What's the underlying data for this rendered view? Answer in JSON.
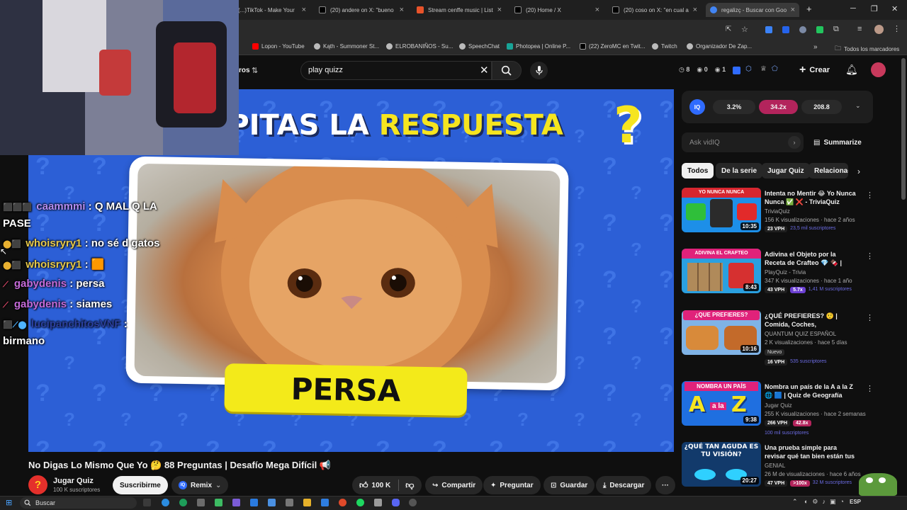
{
  "browser": {
    "tabs": [
      {
        "label": "(...)TikTok - Make Your",
        "color": "#111111"
      },
      {
        "label": "(20) andere on X: \"bueno",
        "color": "#000000"
      },
      {
        "label": "Stream cenffe music | List",
        "color": "#e8532a"
      },
      {
        "label": "(20) Home / X",
        "color": "#000000"
      },
      {
        "label": "(20) coso on X: \"en cual a",
        "color": "#000000"
      },
      {
        "label": "regalizç - Buscar con Goo",
        "color": "#4285f4"
      }
    ],
    "new_tab": "+",
    "bookmarks": [
      {
        "label": "Lopon - YouTube",
        "color": "#ff0000"
      },
      {
        "label": "Kąth - Summoner St...",
        "color": "#bbbbbb"
      },
      {
        "label": "ELROBANIÑOS - Su...",
        "color": "#bbbbbb"
      },
      {
        "label": "SpeechChat",
        "color": "#bbbbbb"
      },
      {
        "label": "Photopea | Online P...",
        "color": "#18a497"
      },
      {
        "label": "(22) ZeroMC en Twit...",
        "color": "#000000"
      },
      {
        "label": "Twitch",
        "color": "#bbbbbb"
      },
      {
        "label": "Organizador De Zap...",
        "color": "#bbbbbb"
      }
    ],
    "bookmarks_overflow": "»",
    "all_bookmarks": "Todos los marcadores"
  },
  "youtube": {
    "filters_fragment": "ros",
    "search_value": "play quizz",
    "stats": {
      "a": "8",
      "b": "0",
      "c": "1"
    },
    "create_label": "Crear",
    "vidiq": {
      "v1": "3.2%",
      "v2": "34.2x",
      "v3": "208.8",
      "ask_placeholder": "Ask vidIQ",
      "summarize": "Summarize"
    },
    "chips": [
      "Todos",
      "De la serie",
      "Jugar Quiz",
      "Relacionad"
    ],
    "video": {
      "banner_white": "EPITAS LA",
      "banner_yellow": "RESPUESTA",
      "answer": "PERSA",
      "question_mark": "?"
    },
    "video_title": "No Digas Lo Mismo Que Yo 🤔 88 Preguntas | Desafío Mega Difícil 📢",
    "channel": {
      "name": "Jugar Quiz",
      "subs": "100 K suscriptores",
      "subscribe": "Suscribirme",
      "remix": "Remix"
    },
    "actions": {
      "likes": "100 K",
      "share": "Compartir",
      "ask": "Preguntar",
      "save": "Guardar",
      "download": "Descargar",
      "more": "···"
    },
    "recommendations": [
      {
        "thumb_text": "YO NUNCA NUNCA",
        "dur": "10:35",
        "title": "Intenta no Mentir 😂 Yo Nunca Nunca ✅ ❌ - TriviaQuiz Part...",
        "channel": "TriviaQuiz",
        "meta": "156 K visualizaciones · hace 2 años",
        "vph": "23 VPH",
        "mult": "",
        "subs": "23,5 mil suscriptores",
        "thumb_color": "#1d8fe8"
      },
      {
        "thumb_text": "ADIVINA EL CRAFTEO",
        "dur": "8:43",
        "title": "Adivina el Objeto por la Receta de Crafteo 💎 🍫 | ¿Cuánto ...",
        "channel": "PlayQuiz - Trivia",
        "meta": "347 K visualizaciones · hace 1 año",
        "vph": "43 VPH",
        "mult": "5.7x",
        "subs": "1,41 M suscriptores",
        "thumb_color": "#2aa0e0"
      },
      {
        "thumb_text": "¿QUE PREFIERES?",
        "dur": "10:16",
        "title": "¿QUÉ PREFIERES? 🤨 | Comida, Coches, Superpoderes y ...",
        "channel": "QUANTUM QUIZ ESPAÑOL",
        "meta": "2 K visualizaciones · hace 5 días",
        "new": "Nuevo",
        "vph": "16 VPH",
        "mult": "",
        "subs": "535 suscriptores",
        "thumb_color": "#7fb3e6"
      },
      {
        "thumb_text": "NOMBRA UN PAÍS",
        "dur": "9:38",
        "title": "Nombra un país de la A a la Z 🌐 🟦 | Quiz de Geografía",
        "channel": "Jugar Quiz",
        "meta": "255 K visualizaciones · hace 2 semanas",
        "vph": "266 VPH",
        "mult": "42.8x",
        "subs": "100 mil suscriptores",
        "thumb_color": "#1f6fe0"
      },
      {
        "thumb_text": "¿QUÉ TAN AGUDA ES TU VISIÓN?",
        "dur": "20:27",
        "title": "Una prueba simple para revisar qué tan bien están tus ojos",
        "channel": "GENIAL",
        "meta": "26 M de visualizaciones · hace 6 años",
        "vph": "47 VPH",
        "mult": ">100x",
        "subs": "32 M suscriptores",
        "thumb_color": "#123a6b"
      }
    ]
  },
  "chat": [
    {
      "user": "caammmi",
      "msg": ": Q MAL Q LA",
      "cont": "PASE",
      "color": "#b58ef2"
    },
    {
      "user": "whoisryry1",
      "msg": ": no sé d gatos",
      "color": "#e6c84a"
    },
    {
      "user": "whoisryry1",
      "msg": ": 🟧",
      "color": "#e6c84a"
    },
    {
      "user": "gabydenis",
      "msg": ": persa",
      "color": "#c46ad8"
    },
    {
      "user": "gabydenis",
      "msg": ": siames",
      "color": "#c46ad8"
    },
    {
      "user": "lucipanchitosVNF",
      "msg": ":",
      "cont": "birmano",
      "color": "#2a3f9f"
    }
  ],
  "taskbar": {
    "search": "Buscar",
    "lang": "ESP"
  }
}
